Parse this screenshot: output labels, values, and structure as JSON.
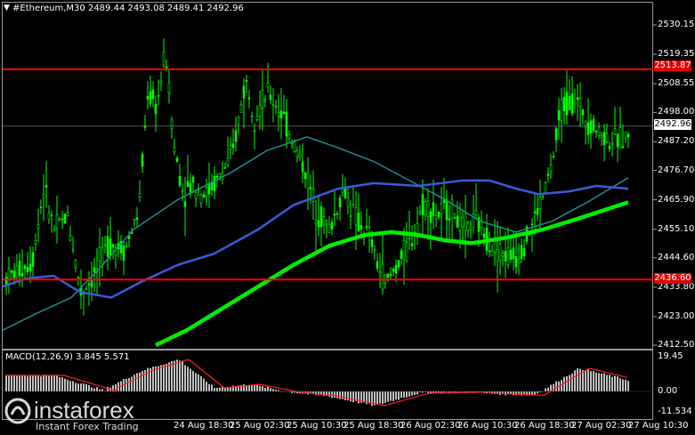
{
  "header": {
    "symbol": "#Ethereum,M30",
    "ohlc": "2489.44 2493.08 2489.41 2492.96"
  },
  "price_axis": [
    "2530.15",
    "2519.35",
    "2508.55",
    "2498.00",
    "2487.20",
    "2476.70",
    "2465.90",
    "2455.10",
    "2444.60",
    "2433.80",
    "2423.00",
    "2412.50"
  ],
  "levels": {
    "resistance": "2513.87",
    "support": "2436.60",
    "current": "2492.96"
  },
  "time_axis": [
    "24 Aug 18:30",
    "25 Aug 02:30",
    "25 Aug 10:30",
    "25 Aug 18:30",
    "26 Aug 02:30",
    "26 Aug 10:30",
    "26 Aug 18:30",
    "27 Aug 02:30",
    "27 Aug 10:30"
  ],
  "macd": {
    "title": "MACD(12,26,9) 3.845 5.571",
    "axis": [
      "19.45",
      "0.00",
      "-11.534"
    ]
  },
  "branding": {
    "name": "instaforex",
    "tagline": "Instant Forex Trading"
  },
  "colors": {
    "background": "#000000",
    "candles": "#00ff00",
    "resistance": "#ff0000",
    "ma_fast": "#1a8f8f",
    "ma_mid": "#3a5bd9",
    "ma_slow": "#00ee00",
    "macd_hist": "#c0c0c0",
    "macd_signal": "#ff2020"
  }
}
